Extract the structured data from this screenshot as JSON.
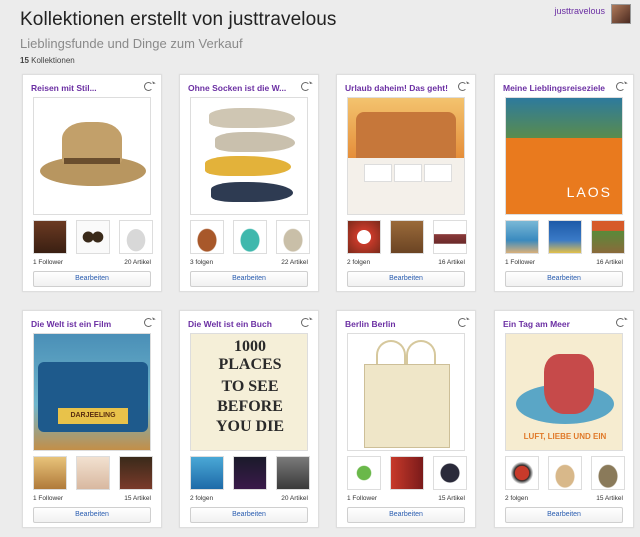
{
  "header": {
    "title": "Kollektionen erstellt von justtravelous",
    "subtitle": "Lieblingsfunde und Dinge zum Verkauf",
    "count_number": "15",
    "count_label": "Kollektionen"
  },
  "user": {
    "name": "justtravelous"
  },
  "edit_label": "Bearbeiten",
  "cards": [
    {
      "title": "Reisen mit Stil...",
      "followers": "1 Follower",
      "items": "20 Artikel"
    },
    {
      "title": "Ohne Socken ist die W...",
      "followers": "3 folgen",
      "items": "22 Artikel"
    },
    {
      "title": "Urlaub daheim! Das geht!",
      "followers": "2 folgen",
      "items": "16 Artikel"
    },
    {
      "title": "Meine Lieblingsreiseziele",
      "followers": "1 Follower",
      "items": "16 Artikel"
    },
    {
      "title": "Die Welt ist ein Film",
      "followers": "1 Follower",
      "items": "15 Artikel"
    },
    {
      "title": "Die Welt ist ein Buch",
      "followers": "2 folgen",
      "items": "20 Artikel"
    },
    {
      "title": "Berlin Berlin",
      "followers": "1 Follower",
      "items": "15 Artikel"
    },
    {
      "title": "Ein Tag am Meer",
      "followers": "2 folgen",
      "items": "15 Artikel"
    }
  ],
  "image_text": {
    "laos": "LAOS",
    "darjeeling": "DARJEELING",
    "book_line1": "1000",
    "book_line2": "PLACES",
    "book_line3": "TO SEE",
    "book_line4": "BEFORE",
    "book_line5": "YOU DIE",
    "meer": "LUFT, LIEBE UND EIN"
  }
}
